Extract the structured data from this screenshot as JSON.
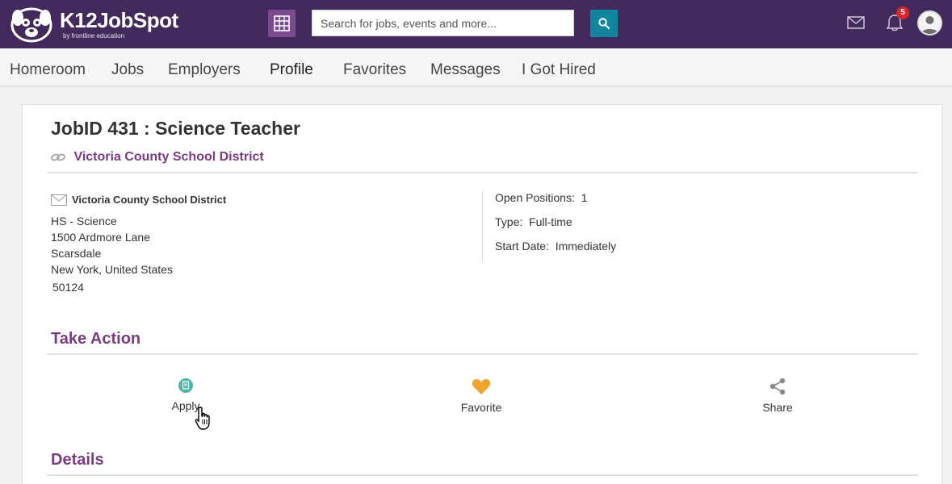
{
  "topbar": {
    "logo_text": "K12JobSpot",
    "logo_sub": "by frontline education",
    "search_placeholder": "Search for jobs, events and more...",
    "notification_count": "5",
    "colors": {
      "bar": "#422b5c",
      "grid_button": "#7a4b8e",
      "search_button": "#12859e",
      "badge": "#d9262b"
    },
    "icons": [
      "grid-icon",
      "search-icon",
      "mail-icon",
      "bell-icon",
      "user-avatar"
    ]
  },
  "nav": {
    "items": [
      {
        "label": "Homeroom"
      },
      {
        "label": "Jobs"
      },
      {
        "label": "Employers"
      },
      {
        "label": "Profile"
      },
      {
        "label": "Favorites"
      },
      {
        "label": "Messages"
      },
      {
        "label": "I Got Hired"
      }
    ]
  },
  "job": {
    "title": "JobID 431 : Science Teacher",
    "district_link": "Victoria County School District",
    "contact_org": "Victoria County School District",
    "address": [
      "HS - Science",
      "1500 Ardmore Lane",
      "Scarsdale",
      "New York, United States",
      "50124"
    ],
    "meta": [
      {
        "key": "Open Positions:",
        "value": "1"
      },
      {
        "key": "Type:",
        "value": "Full-time"
      },
      {
        "key": "Start Date:",
        "value": "Immediately"
      }
    ]
  },
  "take_action": {
    "title": "Take Action",
    "apply": "Apply",
    "favorite": "Favorite",
    "share": "Share",
    "colors": {
      "apply_icon": "#4fb5a7",
      "favorite_icon": "#f0a42b",
      "share_icon": "#888888",
      "accent": "#7a3b83"
    }
  },
  "details": {
    "title": "Details"
  }
}
